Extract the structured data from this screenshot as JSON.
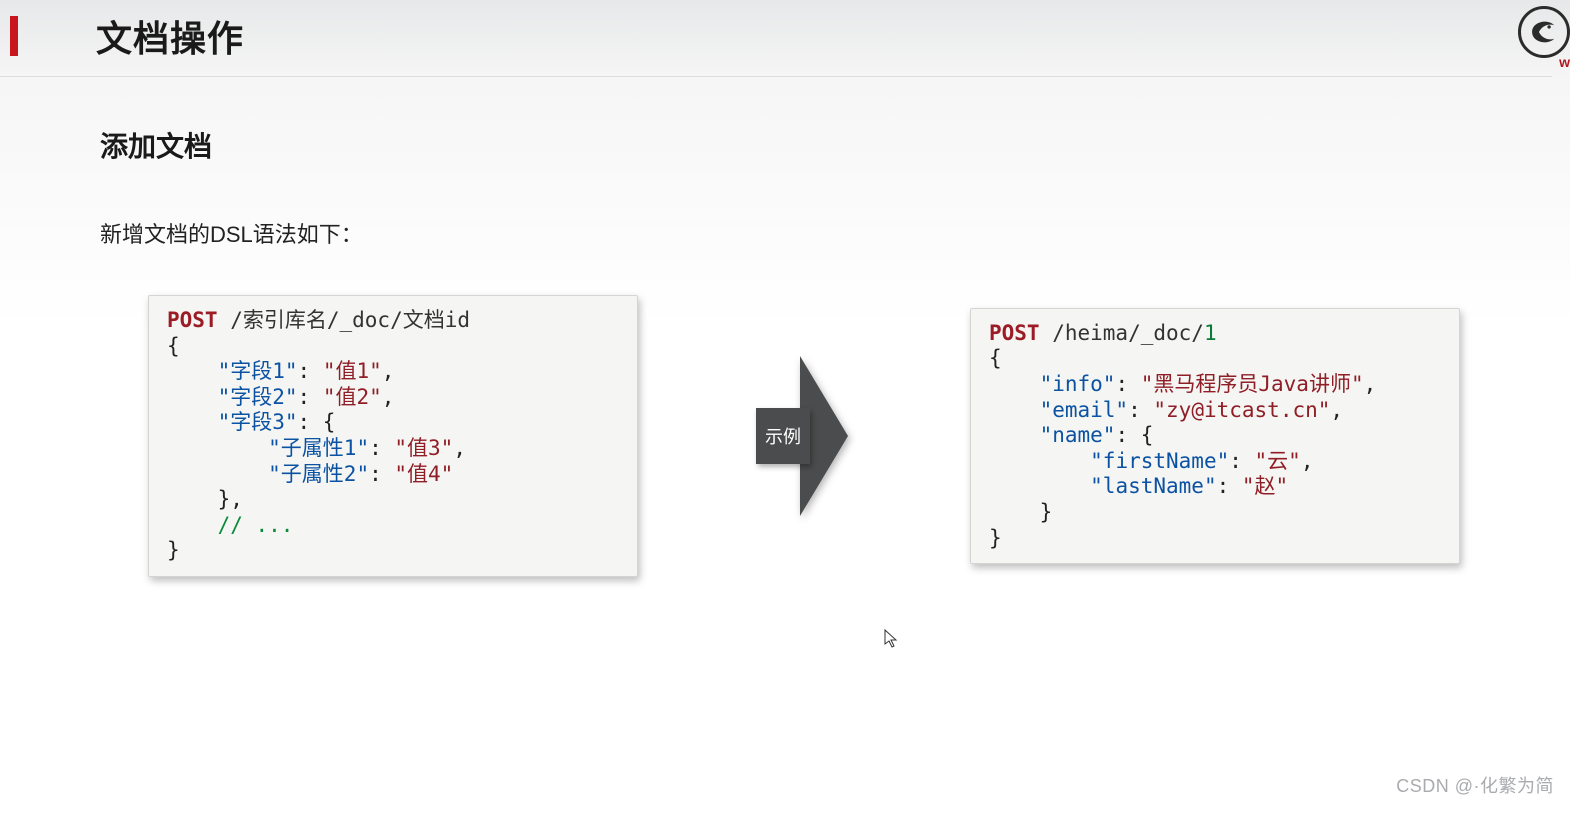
{
  "header": {
    "title": "文档操作",
    "logo_sub": "w"
  },
  "section": {
    "title": "添加文档",
    "intro": "新增文档的DSL语法如下："
  },
  "arrow": {
    "label": "示例"
  },
  "code_left": {
    "method": "POST",
    "path": " /索引库名/_doc/文档id",
    "l1": "{",
    "k1": "\"字段1\"",
    "v1": "\"值1\"",
    "k2": "\"字段2\"",
    "v2": "\"值2\"",
    "k3": "\"字段3\"",
    "k3a": "\"子属性1\"",
    "v3a": "\"值3\"",
    "k3b": "\"子属性2\"",
    "v3b": "\"值4\"",
    "close_inner": "    },",
    "comment": "    // ...",
    "close": "}"
  },
  "code_right": {
    "method": "POST",
    "path": " /heima/_doc/",
    "docid": "1",
    "l1": "{",
    "k1": "\"info\"",
    "v1": "\"黑马程序员Java讲师\"",
    "k2": "\"email\"",
    "v2": "\"zy@itcast.cn\"",
    "k3": "\"name\"",
    "k3a": "\"firstName\"",
    "v3a": "\"云\"",
    "k3b": "\"lastName\"",
    "v3b": "\"赵\"",
    "close_inner": "    }",
    "close": "}"
  },
  "watermark": "CSDN @·化繁为简"
}
